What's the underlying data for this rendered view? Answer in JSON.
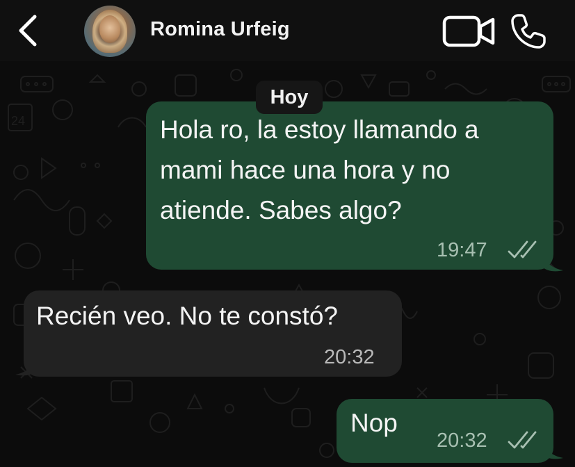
{
  "header": {
    "contact_name": "Romina Urfeig",
    "back_icon": "chevron-left-icon",
    "video_icon": "video-camera-icon",
    "call_icon": "phone-icon"
  },
  "chat": {
    "day_label": "Hoy",
    "messages": [
      {
        "direction": "outgoing",
        "lines": [
          "Hola ro, la estoy llamando a",
          "mami hace una hora y no",
          "atiende. Sabes algo?"
        ],
        "time": "19:47",
        "status": "read-double-check"
      },
      {
        "direction": "incoming",
        "lines": [
          "Recién veo. No te constó?"
        ],
        "time": "20:32"
      },
      {
        "direction": "outgoing",
        "lines": [
          "Nop"
        ],
        "time": "20:32",
        "status": "read-double-check"
      }
    ]
  },
  "colors": {
    "background": "#0c0c0c",
    "outgoing_bubble": "#1f4a33",
    "incoming_bubble": "#222222",
    "text": "#f4f4f4"
  }
}
